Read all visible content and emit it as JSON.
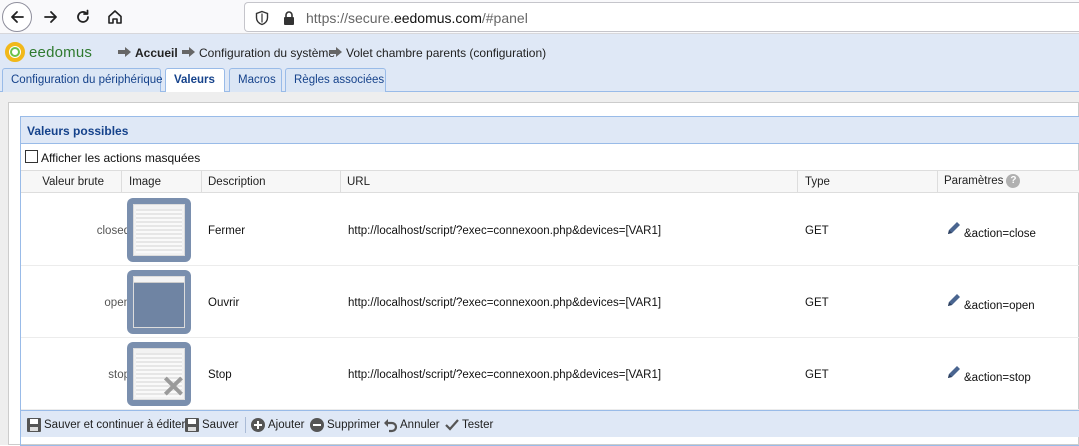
{
  "browser": {
    "url_prefix": "https://secure.",
    "url_domain": "eedomus.com",
    "url_suffix": "/#panel"
  },
  "app": {
    "logo_text": "eedomus",
    "breadcrumb": [
      "Accueil",
      "Configuration du système",
      "Volet chambre parents (configuration)"
    ]
  },
  "tabs": [
    "Configuration du périphérique",
    "Valeurs",
    "Macros",
    "Règles associées"
  ],
  "active_tab": "Valeurs",
  "section": {
    "title": "Valeurs possibles",
    "checkbox_label": "Afficher les actions masquées"
  },
  "table": {
    "headers": [
      "Valeur brute",
      "Image",
      "Description",
      "URL",
      "Type",
      "Paramètres"
    ],
    "rows": [
      {
        "raw": "closed",
        "image": "shutter-closed",
        "description": "Fermer",
        "url": "http://localhost/script/?exec=connexoon.php&devices=[VAR1]",
        "type": "GET",
        "params": "&action=close"
      },
      {
        "raw": "open",
        "image": "shutter-open",
        "description": "Ouvrir",
        "url": "http://localhost/script/?exec=connexoon.php&devices=[VAR1]",
        "type": "GET",
        "params": "&action=open"
      },
      {
        "raw": "stop",
        "image": "shutter-stop",
        "description": "Stop",
        "url": "http://localhost/script/?exec=connexoon.php&devices=[VAR1]",
        "type": "GET",
        "params": "&action=stop"
      }
    ]
  },
  "toolbar": {
    "save_continue": "Sauver et continuer à éditer",
    "save": "Sauver",
    "add": "Ajouter",
    "delete": "Supprimer",
    "cancel": "Annuler",
    "test": "Tester"
  },
  "colors": {
    "header_bg": "#dfe8f6",
    "border_blue": "#99bbe8",
    "title_blue": "#15428b",
    "shutter_frame": "#7a8fae"
  }
}
